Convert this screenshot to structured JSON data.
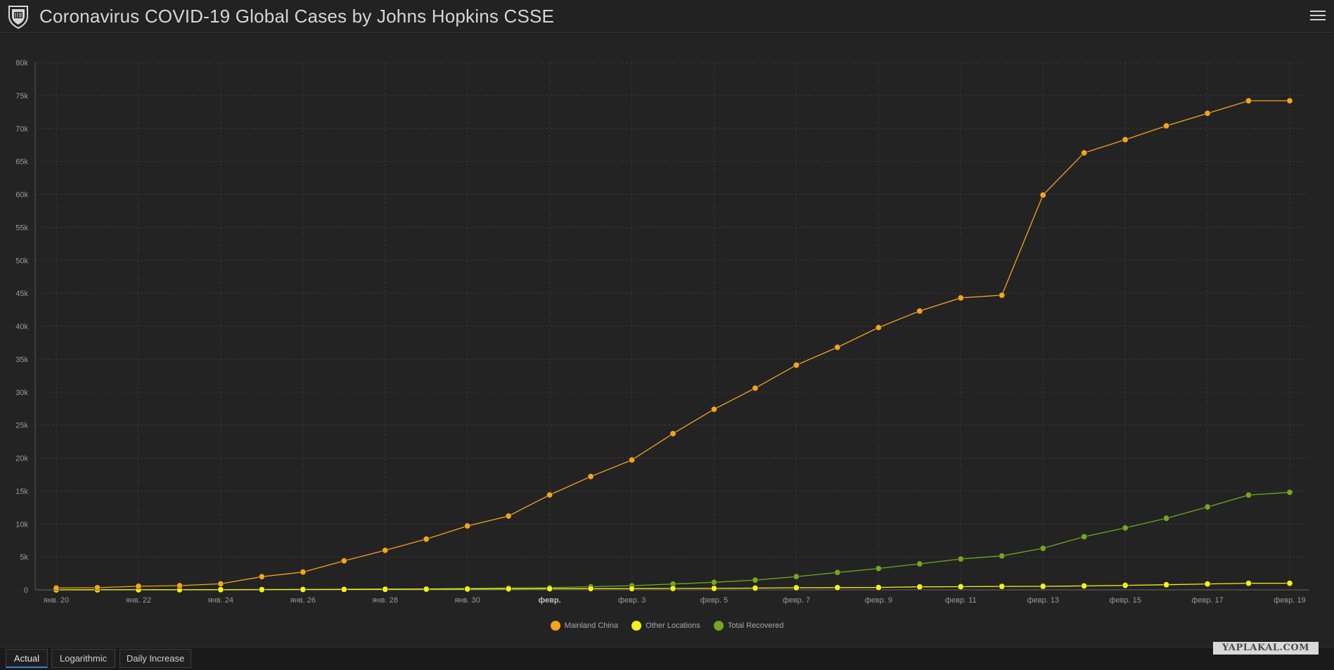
{
  "header": {
    "title": "Coronavirus COVID-19 Global Cases by Johns Hopkins CSSE",
    "logo_icon": "university-shield-icon",
    "menu_icon": "hamburger-menu-icon"
  },
  "tabs": [
    {
      "label": "Actual",
      "active": true
    },
    {
      "label": "Logarithmic",
      "active": false
    },
    {
      "label": "Daily Increase",
      "active": false
    }
  ],
  "watermark": "YAPLAKAL.COM",
  "colors": {
    "mainland_china": "#f5a31e",
    "other_locations": "#f5f01a",
    "total_recovered": "#70a81e",
    "active_tab": "#3b7fd0"
  },
  "chart_data": {
    "type": "line",
    "title": "",
    "xlabel": "",
    "ylabel": "",
    "ylim": [
      0,
      80000
    ],
    "yticks": [
      0,
      5000,
      10000,
      15000,
      20000,
      25000,
      30000,
      35000,
      40000,
      45000,
      50000,
      55000,
      60000,
      65000,
      70000,
      75000,
      80000
    ],
    "ytick_labels": [
      "0",
      "5k",
      "10k",
      "15k",
      "20k",
      "25k",
      "30k",
      "35k",
      "40k",
      "45k",
      "50k",
      "55k",
      "60k",
      "65k",
      "70k",
      "75k",
      "80k"
    ],
    "x": [
      "2020-01-20",
      "2020-01-21",
      "2020-01-22",
      "2020-01-23",
      "2020-01-24",
      "2020-01-25",
      "2020-01-26",
      "2020-01-27",
      "2020-01-28",
      "2020-01-29",
      "2020-01-30",
      "2020-01-31",
      "2020-02-01",
      "2020-02-02",
      "2020-02-03",
      "2020-02-04",
      "2020-02-05",
      "2020-02-06",
      "2020-02-07",
      "2020-02-08",
      "2020-02-09",
      "2020-02-10",
      "2020-02-11",
      "2020-02-12",
      "2020-02-13",
      "2020-02-14",
      "2020-02-15",
      "2020-02-16",
      "2020-02-17",
      "2020-02-18",
      "2020-02-19"
    ],
    "xtick_labels": [
      {
        "x": "2020-01-20",
        "label": "янв. 20",
        "bold": false
      },
      {
        "x": "2020-01-22",
        "label": "янв. 22",
        "bold": false
      },
      {
        "x": "2020-01-24",
        "label": "янв. 24",
        "bold": false
      },
      {
        "x": "2020-01-26",
        "label": "янв. 26",
        "bold": false
      },
      {
        "x": "2020-01-28",
        "label": "янв. 28",
        "bold": false
      },
      {
        "x": "2020-01-30",
        "label": "янв. 30",
        "bold": false
      },
      {
        "x": "2020-02-01",
        "label": "февр.",
        "bold": true
      },
      {
        "x": "2020-02-03",
        "label": "февр. 3",
        "bold": false
      },
      {
        "x": "2020-02-05",
        "label": "февр. 5",
        "bold": false
      },
      {
        "x": "2020-02-07",
        "label": "февр. 7",
        "bold": false
      },
      {
        "x": "2020-02-09",
        "label": "февр. 9",
        "bold": false
      },
      {
        "x": "2020-02-11",
        "label": "февр. 11",
        "bold": false
      },
      {
        "x": "2020-02-13",
        "label": "февр. 13",
        "bold": false
      },
      {
        "x": "2020-02-15",
        "label": "февр. 15",
        "bold": false
      },
      {
        "x": "2020-02-17",
        "label": "февр. 17",
        "bold": false
      },
      {
        "x": "2020-02-19",
        "label": "февр. 19",
        "bold": false
      }
    ],
    "grid": true,
    "legend_position": "bottom-center",
    "series": [
      {
        "name": "Mainland China",
        "color": "#f5a31e",
        "values": [
          278,
          326,
          547,
          639,
          916,
          2000,
          2700,
          4400,
          6000,
          7700,
          9700,
          11200,
          14400,
          17200,
          19700,
          23700,
          27400,
          30600,
          34100,
          36800,
          39800,
          42300,
          44300,
          44700,
          59900,
          66300,
          68300,
          70400,
          72300,
          74200,
          74200
        ]
      },
      {
        "name": "Other Locations",
        "color": "#f5f01a",
        "values": [
          4,
          6,
          8,
          14,
          25,
          40,
          57,
          64,
          87,
          105,
          118,
          153,
          173,
          183,
          188,
          212,
          227,
          265,
          317,
          343,
          361,
          457,
          476,
          523,
          538,
          595,
          685,
          780,
          896,
          999,
          1000
        ]
      },
      {
        "name": "Total Recovered",
        "color": "#70a81e",
        "values": [
          0,
          28,
          28,
          36,
          39,
          52,
          61,
          107,
          126,
          143,
          222,
          284,
          328,
          475,
          630,
          890,
          1150,
          1480,
          2010,
          2640,
          3240,
          3950,
          4680,
          5150,
          6300,
          8060,
          9400,
          10860,
          12580,
          14380,
          14800
        ]
      }
    ]
  }
}
